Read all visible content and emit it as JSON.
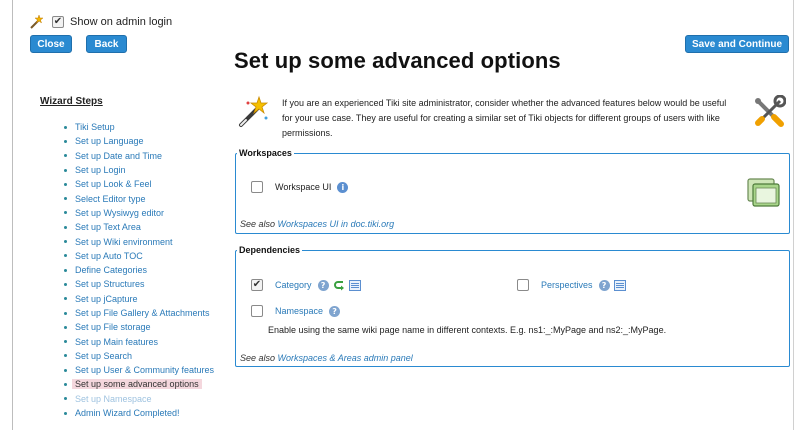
{
  "topbar": {
    "show_on_admin_login_label": "Show on admin login",
    "show_on_admin_login_checked": true
  },
  "buttons": {
    "close": "Close",
    "back": "Back",
    "save_and_continue": "Save and Continue"
  },
  "page_title": "Set up some advanced options",
  "wizard": {
    "title": "Wizard Steps",
    "steps": [
      {
        "label": "Tiki Setup",
        "state": "link"
      },
      {
        "label": "Set up Language",
        "state": "link"
      },
      {
        "label": "Set up Date and Time",
        "state": "link"
      },
      {
        "label": "Set up Login",
        "state": "link"
      },
      {
        "label": "Set up Look & Feel",
        "state": "link"
      },
      {
        "label": "Select Editor type",
        "state": "link"
      },
      {
        "label": "Set up Wysiwyg editor",
        "state": "link"
      },
      {
        "label": "Set up Text Area",
        "state": "link"
      },
      {
        "label": "Set up Wiki environment",
        "state": "link"
      },
      {
        "label": "Set up Auto TOC",
        "state": "link"
      },
      {
        "label": "Define Categories",
        "state": "link"
      },
      {
        "label": "Set up Structures",
        "state": "link"
      },
      {
        "label": "Set up jCapture",
        "state": "link"
      },
      {
        "label": "Set up File Gallery & Attachments",
        "state": "link"
      },
      {
        "label": "Set up File storage",
        "state": "link"
      },
      {
        "label": "Set up Main features",
        "state": "link"
      },
      {
        "label": "Set up Search",
        "state": "link"
      },
      {
        "label": "Set up User & Community features",
        "state": "link"
      },
      {
        "label": "Set up some advanced options",
        "state": "current"
      },
      {
        "label": "Set up Namespace",
        "state": "disabled"
      },
      {
        "label": "Admin Wizard Completed!",
        "state": "link"
      }
    ]
  },
  "intro_text": "If you are an experienced Tiki site administrator, consider whether the advanced features below would be useful for your use case. They are useful for creating a similar set of Tiki objects for different groups of users with like permissions.",
  "workspaces": {
    "legend": "Workspaces",
    "workspace_ui_label": "Workspace UI",
    "workspace_ui_checked": false,
    "see_also_prefix": "See also",
    "see_also_link": "Workspaces UI in doc.tiki.org"
  },
  "dependencies": {
    "legend": "Dependencies",
    "category_label": "Category",
    "category_checked": true,
    "perspectives_label": "Perspectives",
    "perspectives_checked": false,
    "namespace_label": "Namespace",
    "namespace_checked": false,
    "namespace_description": "Enable using the same wiki page name in different contexts. E.g. ns1:_:MyPage and ns2:_:MyPage.",
    "see_also_prefix": "See also",
    "see_also_link": "Workspaces & Areas admin panel"
  },
  "colors": {
    "accent": "#2a8ad1",
    "link": "#2a7ab8",
    "current_step_bg": "#f4d7dd"
  }
}
